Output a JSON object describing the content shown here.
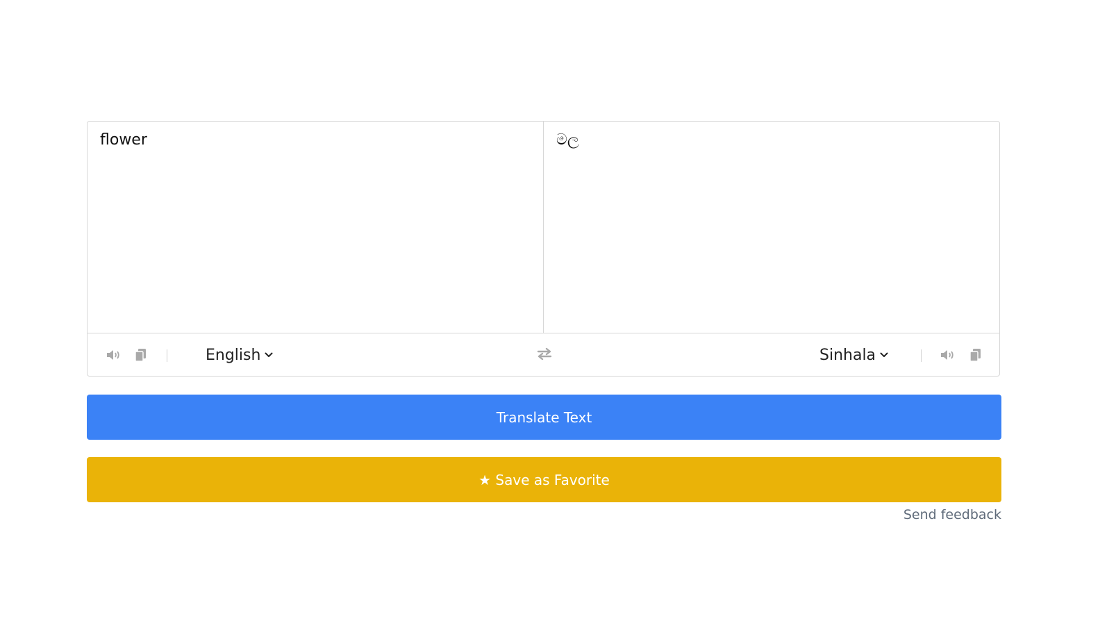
{
  "source": {
    "text": "flower",
    "language": "English"
  },
  "target": {
    "text": "මල",
    "language": "Sinhala"
  },
  "icons": {
    "speaker": "speaker-icon",
    "copy": "copy-icon",
    "chevron": "chevron-down-icon",
    "swap": "swap-arrows-icon"
  },
  "actions": {
    "translate_label": "Translate Text",
    "favorite_label": "★ Save as Favorite",
    "feedback_label": "Send feedback"
  },
  "colors": {
    "translate_button": "#3b82f6",
    "favorite_button": "#eab308",
    "icon_gray": "#a9a9a9",
    "feedback_text": "#5f6b7a"
  }
}
